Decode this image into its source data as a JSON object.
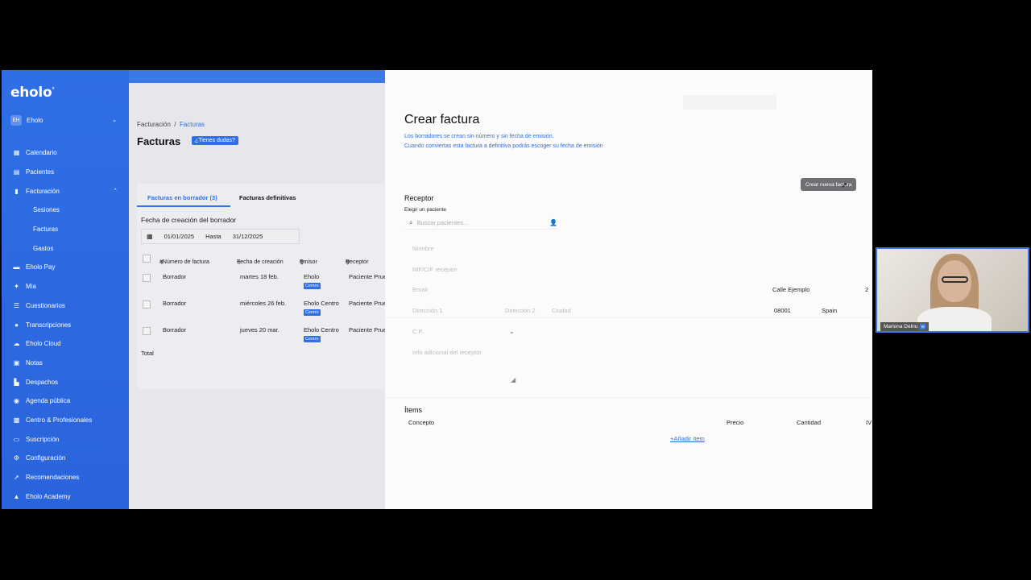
{
  "colors": {
    "brand": "#2f6fe6",
    "tag": "#2f6fe6"
  },
  "sidebar": {
    "logo": "eholo",
    "org": {
      "initials": "EH",
      "name": "Eholo"
    },
    "items": [
      {
        "label": "Calendario",
        "icon": "calendar-icon"
      },
      {
        "label": "Pacientes",
        "icon": "patients-icon"
      },
      {
        "label": "Facturación",
        "icon": "invoice-icon"
      },
      {
        "label": "Sesiones",
        "sub": true
      },
      {
        "label": "Facturas",
        "sub": true
      },
      {
        "label": "Gastos",
        "sub": true
      },
      {
        "label": "Eholo Pay",
        "icon": "card-icon"
      },
      {
        "label": "Mia",
        "icon": "sparkle-icon"
      },
      {
        "label": "Cuestionarios",
        "icon": "list-icon"
      },
      {
        "label": "Transcripciones",
        "icon": "mic-icon"
      },
      {
        "label": "Eholo Cloud",
        "icon": "cloud-icon"
      },
      {
        "label": "Notas",
        "icon": "notes-icon"
      },
      {
        "label": "Despachos",
        "icon": "building-icon"
      },
      {
        "label": "Agenda pública",
        "icon": "globe-icon"
      },
      {
        "label": "Centro & Profesionales",
        "icon": "team-icon"
      },
      {
        "label": "Suscripción",
        "icon": "subscription-icon"
      },
      {
        "label": "Configuración",
        "icon": "gear-icon"
      },
      {
        "label": "Recomendaciones",
        "icon": "rocket-icon"
      },
      {
        "label": "Eholo Academy",
        "icon": "academy-icon"
      }
    ]
  },
  "main": {
    "breadcrumb": {
      "parent": "Facturación",
      "separator": "/",
      "current": "Facturas"
    },
    "title": "Facturas",
    "help": "¿Tienes dudas?",
    "tabs": {
      "draft": "Facturas en borrador (3)",
      "final": "Facturas definitivas"
    },
    "filter_label": "Fecha de creación del borrador",
    "date_from": "01/01/2025",
    "date_to_label": "Hasta",
    "date_to": "31/12/2025",
    "columns": [
      "#Número de factura",
      "Fecha de creación",
      "Emisor",
      "Receptor"
    ],
    "rows": [
      {
        "numero": "Borrador",
        "fecha": "martes 18 feb.",
        "emisor": "Eholo",
        "tag": "Centro",
        "receptor": "Paciente Prue"
      },
      {
        "numero": "Borrador",
        "fecha": "miércoles 26 feb.",
        "emisor": "Eholo Centro",
        "tag": "Centro",
        "receptor": "Paciente Prue"
      },
      {
        "numero": "Borrador",
        "fecha": "jueves 20 mar.",
        "emisor": "Eholo Centro",
        "tag": "Centro",
        "receptor": "Paciente Prue"
      }
    ],
    "total_label": "Total"
  },
  "drawer": {
    "title": "Crear factura",
    "note1": "Los borradores se crean sin número y sin fecha de emisión.",
    "note2": "Cuando conviertas esta factura a definitiva podrás escoger su fecha de emisión",
    "tooltip": "Crear nueva factura",
    "receptor_title": "Receptor",
    "choose_patient": "Elegir un paciente",
    "search_placeholder": "Buscar pacientes...",
    "fields": {
      "nombre": "Nombre",
      "nif": "NIF/CIF receptor",
      "email": "Email",
      "dir1": "Dirección 1",
      "dir2": "Dirección 2",
      "ciudad": "Ciudad",
      "cp": "C.P.",
      "info": "Info adicional del receptor"
    },
    "values": {
      "street": "Calle Ejemplo",
      "number": "2",
      "cp": "08001",
      "country": "Spain"
    },
    "items_title": "Ítems",
    "item_columns": {
      "concepto": "Concepto",
      "precio": "Precio",
      "cantidad": "Cantidad",
      "iva": "IV"
    },
    "add_item": "Añadir ítem"
  },
  "webcam": {
    "name": "Mariona Delriu",
    "badge": "M"
  }
}
